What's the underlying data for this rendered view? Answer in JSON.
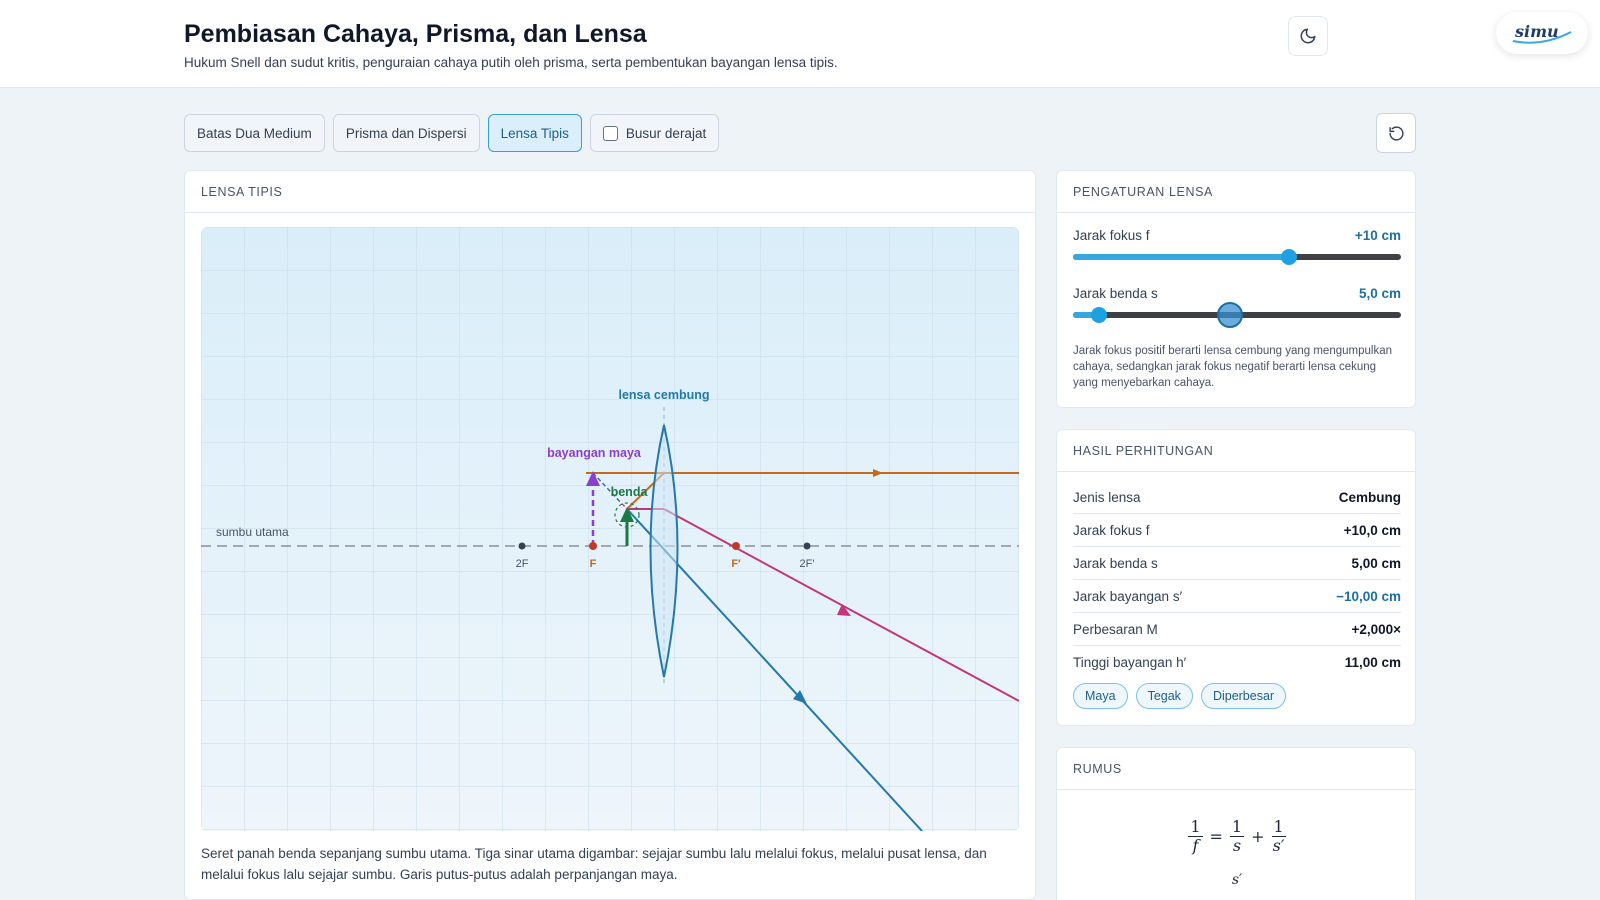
{
  "header": {
    "title": "Pembiasan Cahaya, Prisma, dan Lensa",
    "subtitle": "Hukum Snell dan sudut kritis, penguraian cahaya putih oleh prisma, serta pembentukan bayangan lensa tipis.",
    "logo_text": "simu"
  },
  "tabs": [
    {
      "label": "Batas Dua Medium",
      "active": false
    },
    {
      "label": "Prisma dan Dispersi",
      "active": false
    },
    {
      "label": "Lensa Tipis",
      "active": true
    }
  ],
  "protractor": {
    "label": "Busur derajat",
    "checked": false
  },
  "sim": {
    "heading": "LENSA TIPIS",
    "axis_label": "sumbu utama",
    "lens_label": "lensa cembung",
    "image_label": "bayangan maya",
    "object_label": "benda",
    "points": {
      "f_left": "F",
      "f2_left": "2F",
      "f_right": "F′",
      "f2_right": "2F′"
    },
    "caption": "Seret panah benda sepanjang sumbu utama. Tiga sinar utama digambar: sejajar sumbu lalu melalui fokus, melalui pusat lensa, dan melalui fokus lalu sejajar sumbu. Garis putus-putus adalah perpanjangan maya.",
    "colors": {
      "ray_parallel": "#c2367a",
      "ray_center": "#2379a8",
      "ray_focus": "#c46a1e",
      "object": "#1a7a43",
      "image": "#8b3fd1",
      "lens": "#2379a8"
    }
  },
  "controls": {
    "heading": "PENGATURAN LENSA",
    "focal": {
      "label": "Jarak fokus f",
      "value_text": "+10 cm",
      "fraction": 0.66
    },
    "object_distance": {
      "label": "Jarak benda s",
      "value_text": "5,0 cm",
      "fraction": 0.08,
      "hover_fraction": 0.48
    },
    "note": "Jarak fokus positif berarti lensa cembung yang mengumpulkan cahaya, sedangkan jarak fokus negatif berarti lensa cekung yang menyebarkan cahaya."
  },
  "results": {
    "heading": "HASIL PERHITUNGAN",
    "rows": [
      {
        "k": "Jenis lensa",
        "v": "Cembung"
      },
      {
        "k": "Jarak fokus f",
        "v": "+10,0 cm"
      },
      {
        "k": "Jarak benda s",
        "v": "5,00 cm"
      },
      {
        "k": "Jarak bayangan s′",
        "v": "−10,00 cm"
      },
      {
        "k": "Perbesaran M",
        "v": "+2,000×"
      },
      {
        "k": "Tinggi bayangan h′",
        "v": "11,00 cm"
      }
    ],
    "chips": [
      "Maya",
      "Tegak",
      "Diperbesar"
    ]
  },
  "formula": {
    "heading": "RUMUS",
    "one": "1",
    "f": "f",
    "s": "s",
    "s_prime": "s′",
    "equals": "=",
    "plus": "+",
    "second_line": "s′"
  }
}
